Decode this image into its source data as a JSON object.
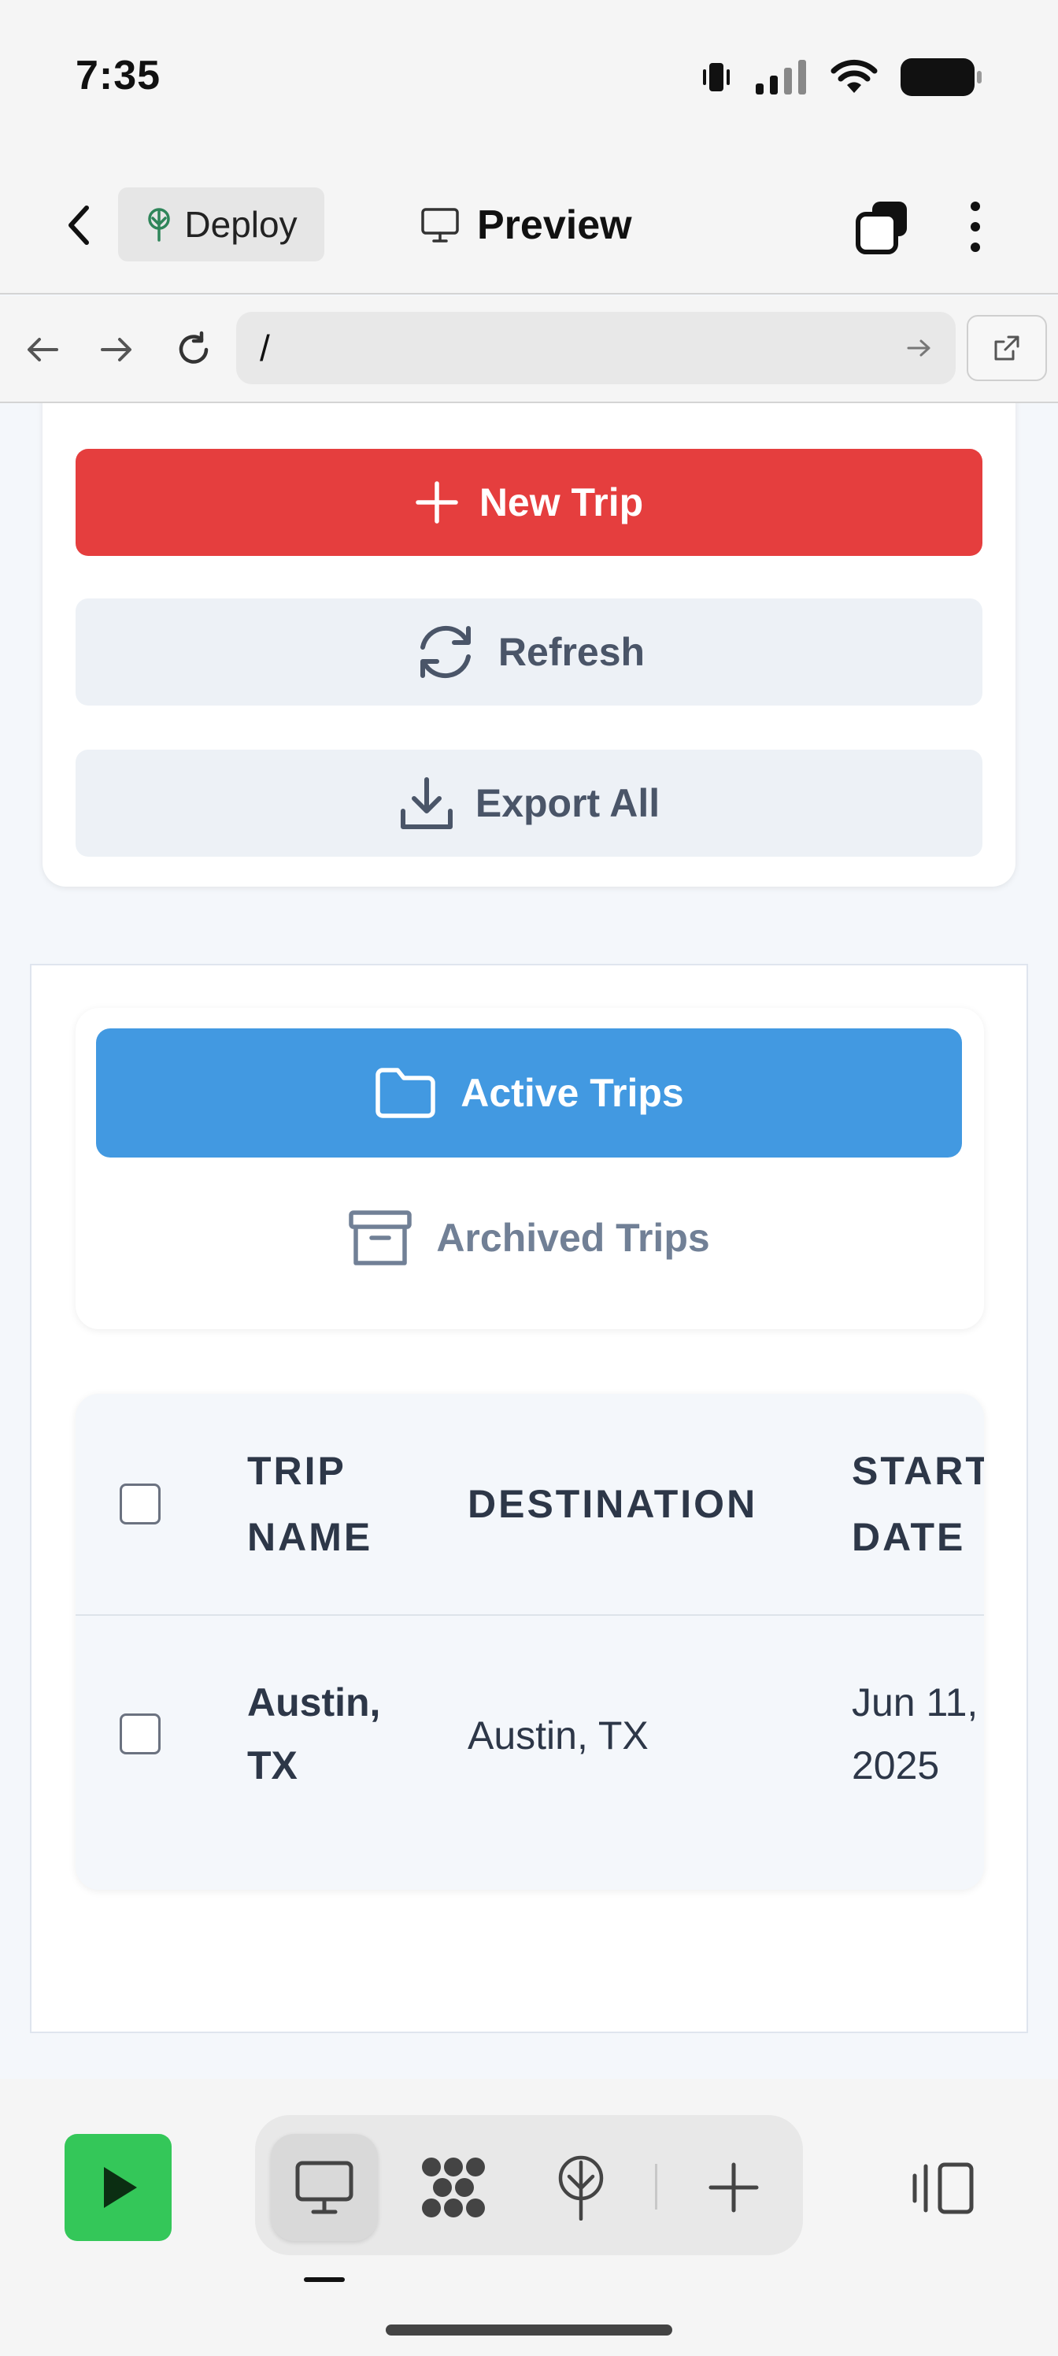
{
  "status_bar": {
    "time": "7:35"
  },
  "header": {
    "deploy_label": "Deploy",
    "preview_label": "Preview"
  },
  "url_bar": {
    "url": "/"
  },
  "actions": {
    "new_trip": "New Trip",
    "refresh": "Refresh",
    "export_all": "Export All"
  },
  "trip_tabs": {
    "active": "Active Trips",
    "archived": "Archived Trips"
  },
  "table": {
    "columns": [
      {
        "line1": "TRIP",
        "line2": "NAME"
      },
      {
        "line1": "DESTINATION",
        "line2": ""
      },
      {
        "line1": "START",
        "line2": "DATE"
      }
    ],
    "rows": [
      {
        "trip_name_line1": "Austin,",
        "trip_name_line2": "TX",
        "destination": "Austin, TX",
        "start_line1": "Jun 11,",
        "start_line2": "2025"
      }
    ]
  },
  "colors": {
    "new_trip": "#e53e3e",
    "active_tab": "#4299e1",
    "run_button": "#34c759",
    "secondary_button": "#edf1f6"
  },
  "icons": {
    "back": "chevron-left-icon",
    "deploy": "deploy-tree-icon",
    "preview": "monitor-icon",
    "tabs": "tabs-icon",
    "more": "more-vertical-icon",
    "new_trip": "plus-icon",
    "refresh": "refresh-icon",
    "export": "download-icon",
    "active_trips": "folder-icon",
    "archived_trips": "archive-icon"
  }
}
